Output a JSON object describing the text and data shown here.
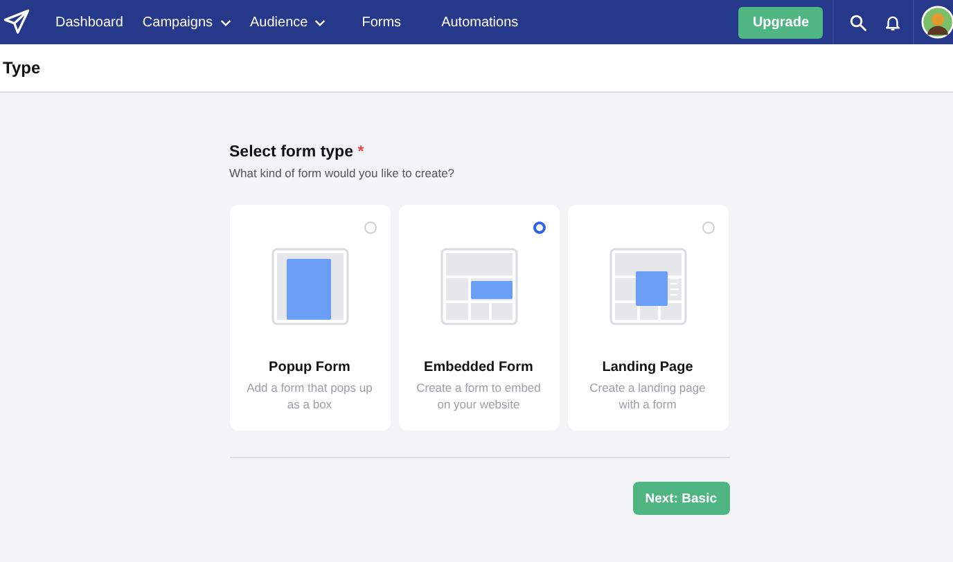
{
  "nav": {
    "items": [
      {
        "label": "Dashboard",
        "kind": "link"
      },
      {
        "label": "Campaigns",
        "kind": "dropdown"
      },
      {
        "label": "Audience",
        "kind": "dropdown"
      },
      {
        "label": "Forms",
        "kind": "link"
      },
      {
        "label": "Automations",
        "kind": "link"
      }
    ],
    "upgrade": "Upgrade"
  },
  "page_title": "Type",
  "question": {
    "label": "Select form type",
    "required_mark": "*",
    "hint": "What kind of form would you like to create?"
  },
  "options": [
    {
      "kind": "popup",
      "title": "Popup Form",
      "description": "Add a form that pops up as a box",
      "selected": false
    },
    {
      "kind": "embedded",
      "title": "Embedded Form",
      "description": "Create a form to embed on your website",
      "selected": true
    },
    {
      "kind": "landing",
      "title": "Landing Page",
      "description": "Create a landing page with a form",
      "selected": false
    }
  ],
  "next_button": "Next: Basic"
}
